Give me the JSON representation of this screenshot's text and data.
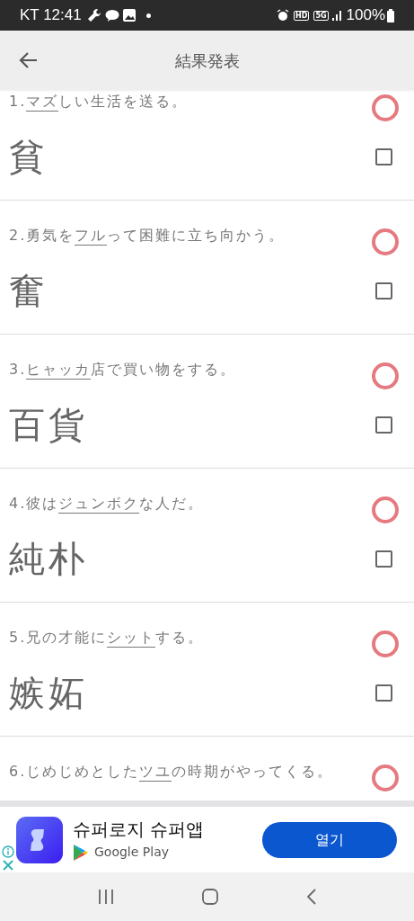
{
  "status_bar": {
    "carrier_time": "KT 12:41",
    "badges": [
      "HD",
      "5G"
    ],
    "battery": "100%"
  },
  "header": {
    "title": "結果発表"
  },
  "items": [
    {
      "parts": [
        {
          "text": "1.",
          "underlined": false
        },
        {
          "text": "マズ",
          "underlined": true
        },
        {
          "text": "しい生活を送る。",
          "underlined": false
        }
      ],
      "answer": "貧",
      "correct": true,
      "checked": false
    },
    {
      "parts": [
        {
          "text": "2.勇気を",
          "underlined": false
        },
        {
          "text": "フル",
          "underlined": true
        },
        {
          "text": "って困難に立ち向かう。",
          "underlined": false
        }
      ],
      "answer": "奮",
      "correct": true,
      "checked": false
    },
    {
      "parts": [
        {
          "text": "3.",
          "underlined": false
        },
        {
          "text": "ヒャッカ",
          "underlined": true
        },
        {
          "text": "店で買い物をする。",
          "underlined": false
        }
      ],
      "answer": "百貨",
      "correct": true,
      "checked": false
    },
    {
      "parts": [
        {
          "text": "4.彼は",
          "underlined": false
        },
        {
          "text": "ジュンボク",
          "underlined": true
        },
        {
          "text": "な人だ。",
          "underlined": false
        }
      ],
      "answer": "純朴",
      "correct": true,
      "checked": false
    },
    {
      "parts": [
        {
          "text": "5.兄の才能に",
          "underlined": false
        },
        {
          "text": "シット",
          "underlined": true
        },
        {
          "text": "する。",
          "underlined": false
        }
      ],
      "answer": "嫉妬",
      "correct": true,
      "checked": false
    },
    {
      "parts": [
        {
          "text": "6.じめじめとした",
          "underlined": false
        },
        {
          "text": "ツユ",
          "underlined": true
        },
        {
          "text": "の時期がやってくる。",
          "underlined": false
        }
      ],
      "correct": true
    }
  ],
  "ad": {
    "title": "슈퍼로지 슈퍼앱",
    "store": "Google Play",
    "button": "열기"
  }
}
